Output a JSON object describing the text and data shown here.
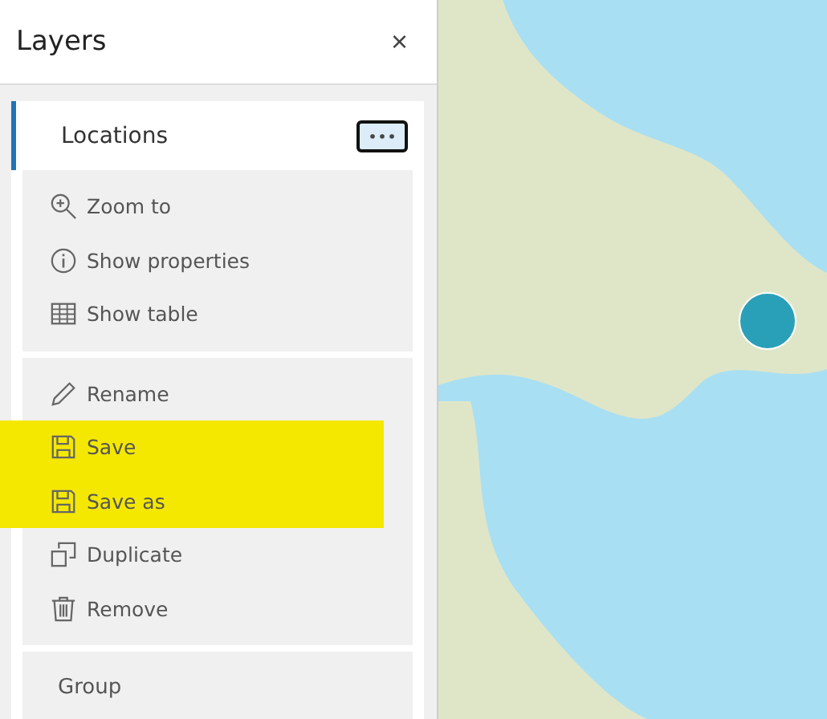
{
  "panel": {
    "title": "Layers",
    "close": "×"
  },
  "layer": {
    "name": "Locations",
    "selected": true,
    "menu_open": true
  },
  "menu_groups": [
    [
      {
        "label": "Zoom to",
        "kind": "zoom",
        "highlighted": false
      },
      {
        "label": "Show properties",
        "kind": "info",
        "highlighted": false
      },
      {
        "label": "Show table",
        "kind": "table",
        "highlighted": false
      }
    ],
    [
      {
        "label": "Rename",
        "kind": "rename",
        "highlighted": false
      },
      {
        "label": "Save",
        "kind": "save",
        "highlighted": true
      },
      {
        "label": "Save as",
        "kind": "save",
        "highlighted": true
      },
      {
        "label": "Duplicate",
        "kind": "duplicate",
        "highlighted": false
      },
      {
        "label": "Remove",
        "kind": "remove",
        "highlighted": false
      }
    ]
  ],
  "next_layer": {
    "name": "Group"
  }
}
